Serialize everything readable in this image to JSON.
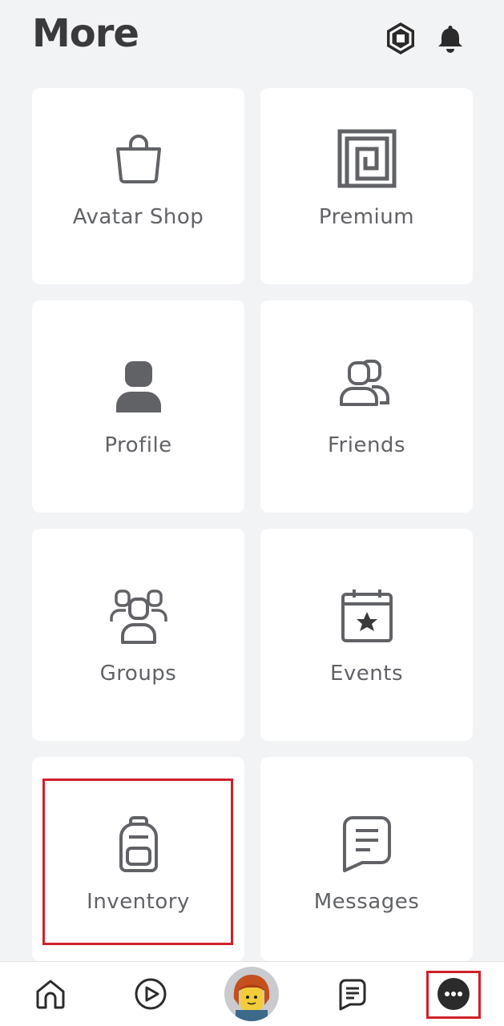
{
  "header": {
    "title": "More"
  },
  "tiles": [
    {
      "label": "Avatar Shop",
      "icon": "shopping-bag-icon"
    },
    {
      "label": "Premium",
      "icon": "premium-icon"
    },
    {
      "label": "Profile",
      "icon": "person-icon"
    },
    {
      "label": "Friends",
      "icon": "friends-icon"
    },
    {
      "label": "Groups",
      "icon": "groups-icon"
    },
    {
      "label": "Events",
      "icon": "calendar-star-icon"
    },
    {
      "label": "Inventory",
      "icon": "backpack-icon"
    },
    {
      "label": "Messages",
      "icon": "message-icon"
    }
  ],
  "nav": [
    {
      "name": "home",
      "icon": "home-icon"
    },
    {
      "name": "discover",
      "icon": "play-icon"
    },
    {
      "name": "avatar",
      "icon": "avatar-icon"
    },
    {
      "name": "chat",
      "icon": "chat-icon"
    },
    {
      "name": "more",
      "icon": "more-dots-icon"
    }
  ],
  "colors": {
    "highlight": "#d0202b",
    "icon": "#606266",
    "background": "#f2f3f5"
  }
}
